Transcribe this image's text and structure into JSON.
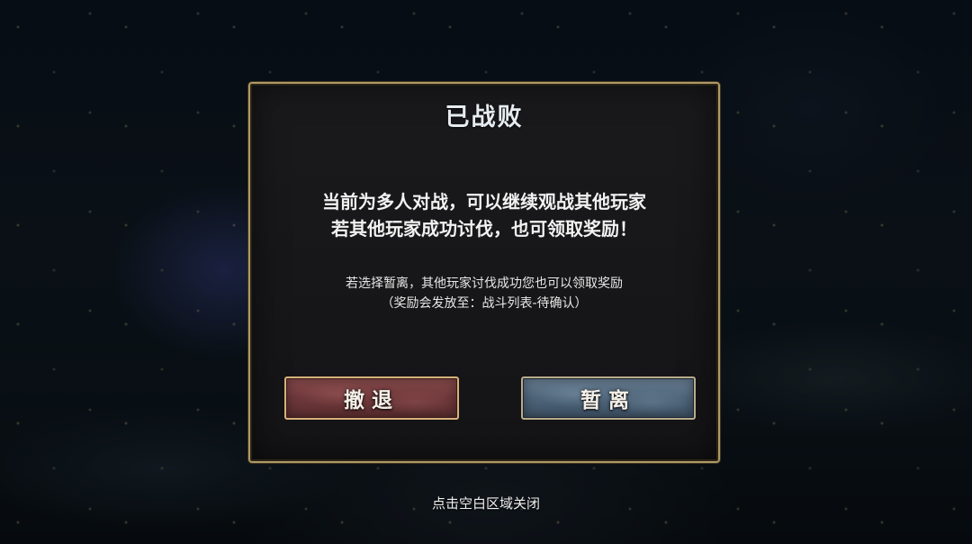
{
  "dialog": {
    "title": "已战败",
    "message_lines": [
      "当前为多人对战，可以继续观战其他玩家",
      "若其他玩家成功讨伐，也可领取奖励！"
    ],
    "note_lines": [
      "若选择暂离，其他玩家讨伐成功您也可以领取奖励",
      "（奖励会发放至：战斗列表-待确认）"
    ],
    "retreat_label": "撤退",
    "leave_label": "暂离"
  },
  "footer": {
    "close_hint": "点击空白区域关闭"
  }
}
